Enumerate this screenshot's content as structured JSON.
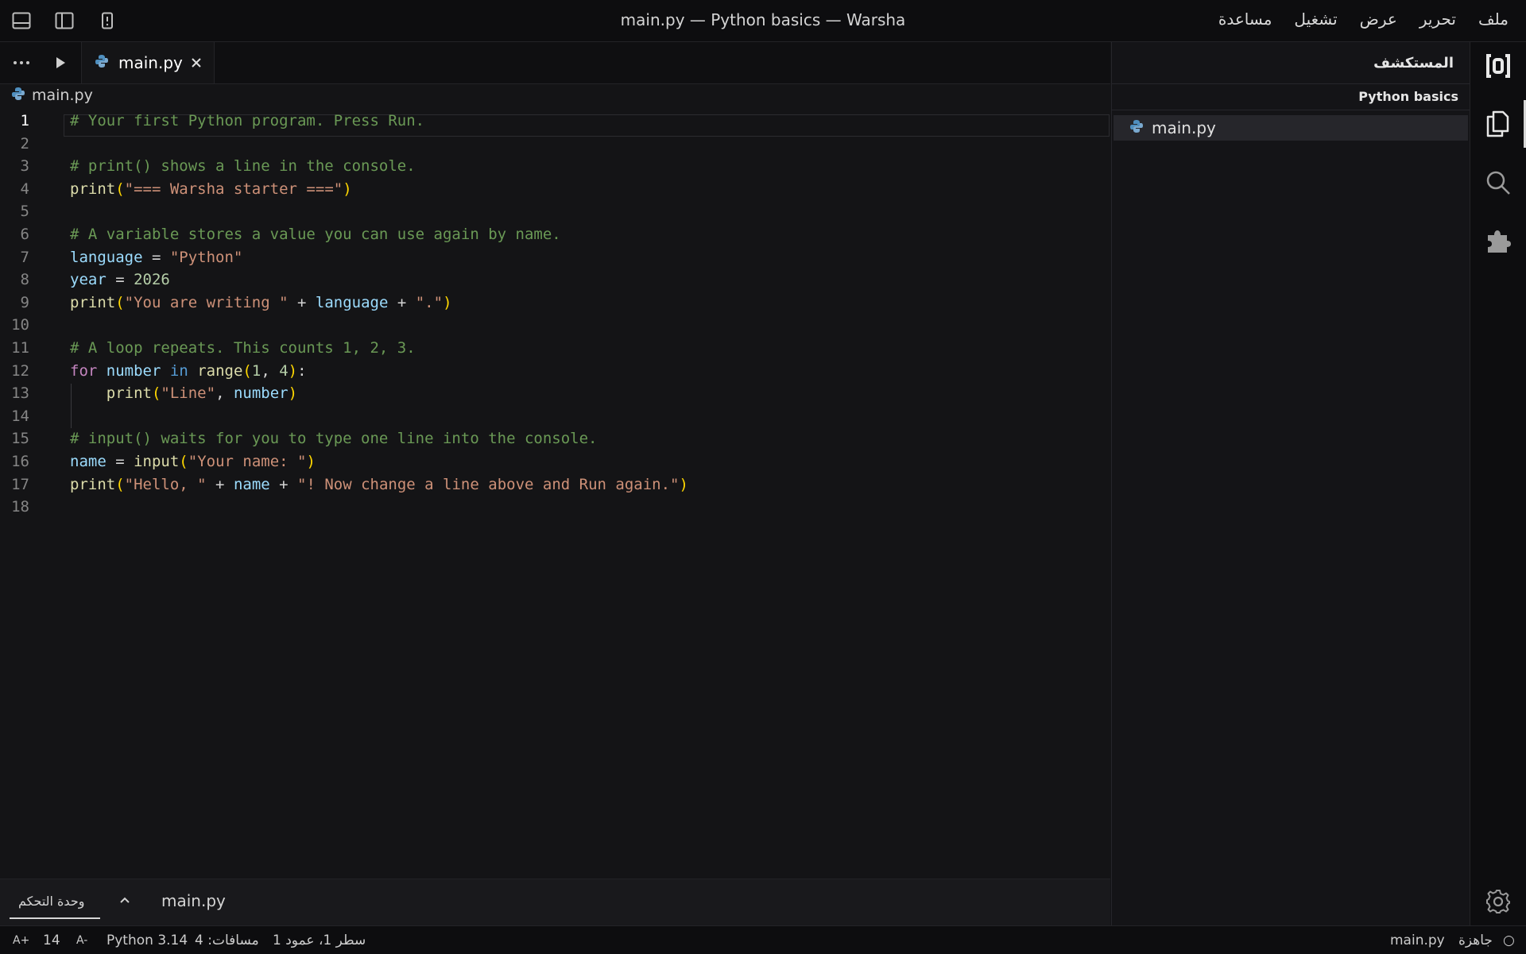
{
  "titlebar": {
    "title": "main.py — Python basics — Warsha",
    "menu": [
      "ملف",
      "تحرير",
      "عرض",
      "تشغيل",
      "مساعدة"
    ],
    "icons": [
      "panel-bottom-icon",
      "panel-left-icon",
      "mobile-icon"
    ]
  },
  "activity_bar": {
    "items": [
      "logo-icon",
      "files-icon",
      "search-icon",
      "extensions-icon",
      "settings-icon"
    ],
    "active": "files-icon"
  },
  "explorer": {
    "header": "المستكشف",
    "project": "Python basics",
    "files": [
      "main.py"
    ]
  },
  "tabs": {
    "active_tab": "main.py",
    "icons": [
      "more-icon",
      "run-icon",
      "close-icon"
    ]
  },
  "breadcrumb": "main.py",
  "editor": {
    "current_line": 1,
    "lines": [
      [
        [
          "c",
          "# Your first Python program. Press Run."
        ]
      ],
      [],
      [
        [
          "c",
          "# print() shows a line in the console."
        ]
      ],
      [
        [
          "f",
          "print"
        ],
        [
          "p",
          "("
        ],
        [
          "s",
          "\"=== Warsha starter ===\""
        ],
        [
          "p",
          ")"
        ]
      ],
      [],
      [
        [
          "c",
          "# A variable stores a value you can use again by name."
        ]
      ],
      [
        [
          "v",
          "language"
        ],
        [
          "o",
          " = "
        ],
        [
          "s",
          "\"Python\""
        ]
      ],
      [
        [
          "v",
          "year"
        ],
        [
          "o",
          " = "
        ],
        [
          "n",
          "2026"
        ]
      ],
      [
        [
          "f",
          "print"
        ],
        [
          "p",
          "("
        ],
        [
          "s",
          "\"You are writing \""
        ],
        [
          "o",
          " + "
        ],
        [
          "v",
          "language"
        ],
        [
          "o",
          " + "
        ],
        [
          "s",
          "\".\""
        ],
        [
          "p",
          ")"
        ]
      ],
      [],
      [
        [
          "c",
          "# A loop repeats. This counts 1, 2, 3."
        ]
      ],
      [
        [
          "k",
          "for"
        ],
        [
          "o",
          " "
        ],
        [
          "v",
          "number"
        ],
        [
          "o",
          " "
        ],
        [
          "kw",
          "in"
        ],
        [
          "o",
          " "
        ],
        [
          "f",
          "range"
        ],
        [
          "p",
          "("
        ],
        [
          "n",
          "1"
        ],
        [
          "o",
          ", "
        ],
        [
          "n",
          "4"
        ],
        [
          "p",
          ")"
        ],
        [
          "o",
          ":"
        ]
      ],
      [
        [
          "o",
          "    "
        ],
        [
          "f",
          "print"
        ],
        [
          "p",
          "("
        ],
        [
          "s",
          "\"Line\""
        ],
        [
          "o",
          ", "
        ],
        [
          "v",
          "number"
        ],
        [
          "p",
          ")"
        ]
      ],
      [],
      [
        [
          "c",
          "# input() waits for you to type one line into the console."
        ]
      ],
      [
        [
          "v",
          "name"
        ],
        [
          "o",
          " = "
        ],
        [
          "f",
          "input"
        ],
        [
          "p",
          "("
        ],
        [
          "s",
          "\"Your name: \""
        ],
        [
          "p",
          ")"
        ]
      ],
      [
        [
          "f",
          "print"
        ],
        [
          "p",
          "("
        ],
        [
          "s",
          "\"Hello, \""
        ],
        [
          "o",
          " + "
        ],
        [
          "v",
          "name"
        ],
        [
          "o",
          " + "
        ],
        [
          "s",
          "\"! Now change a line above and Run again.\""
        ],
        [
          "p",
          ")"
        ]
      ],
      []
    ]
  },
  "panel": {
    "console_tab": "وحدة التحكم",
    "file_tab": "main.py"
  },
  "status": {
    "font_increase": "A+",
    "font_size": "14",
    "font_decrease": "A-",
    "language": "Python 3.14",
    "cursor": "سطر 1، عمود 1",
    "spaces": "مسافات: 4",
    "file": "main.py",
    "state": "جاهزة",
    "state_symbol": "○"
  },
  "colors": {
    "comment": "#6a9955",
    "function": "#dcdcaa",
    "string": "#ce9178",
    "variable": "#9cdcfe",
    "number": "#b5cea8",
    "keyword_control": "#c586c0",
    "keyword": "#569cd6",
    "bracket": "#ffd700",
    "python_icon": "#4f8fbf"
  }
}
